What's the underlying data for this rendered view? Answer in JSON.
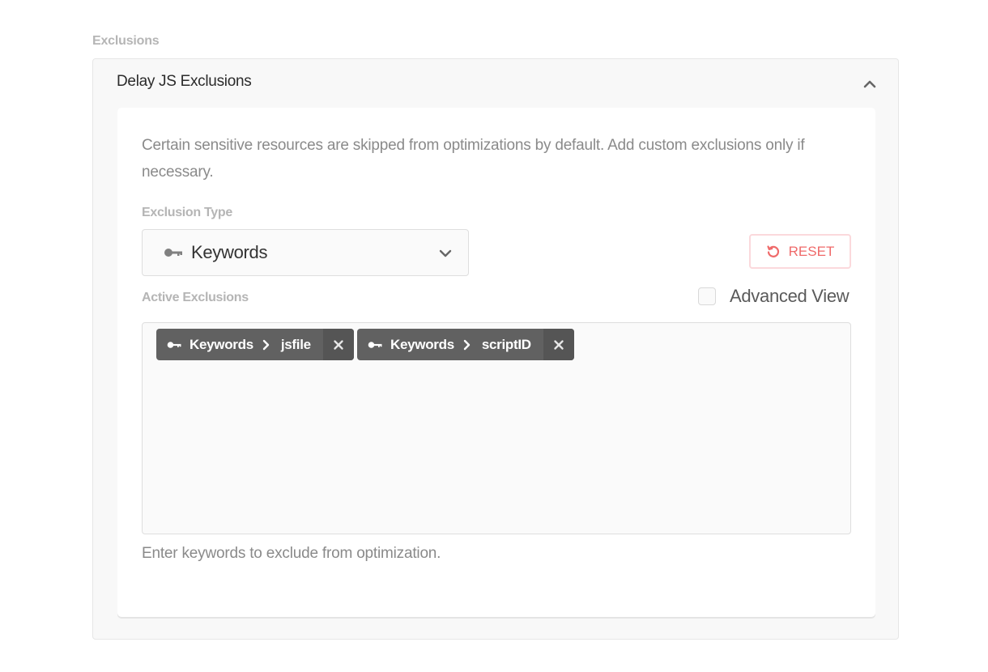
{
  "section": {
    "label": "Exclusions"
  },
  "panel": {
    "title": "Delay JS Exclusions",
    "description": "Certain sensitive resources are skipped from optimizations by default. Add custom exclusions only if necessary.",
    "exclusion_type": {
      "label": "Exclusion Type",
      "selected": "Keywords",
      "icon": "key-icon"
    },
    "reset_label": "RESET",
    "advanced_view_label": "Advanced View",
    "advanced_view_checked": false,
    "active_exclusions": {
      "label": "Active Exclusions",
      "tags": [
        {
          "type": "Keywords",
          "value": "jsfile"
        },
        {
          "type": "Keywords",
          "value": "scriptID"
        }
      ]
    },
    "helper_text": "Enter keywords to exclude from optimization."
  },
  "colors": {
    "reset_accent": "#ef6a6a",
    "tag_background": "#616161"
  }
}
